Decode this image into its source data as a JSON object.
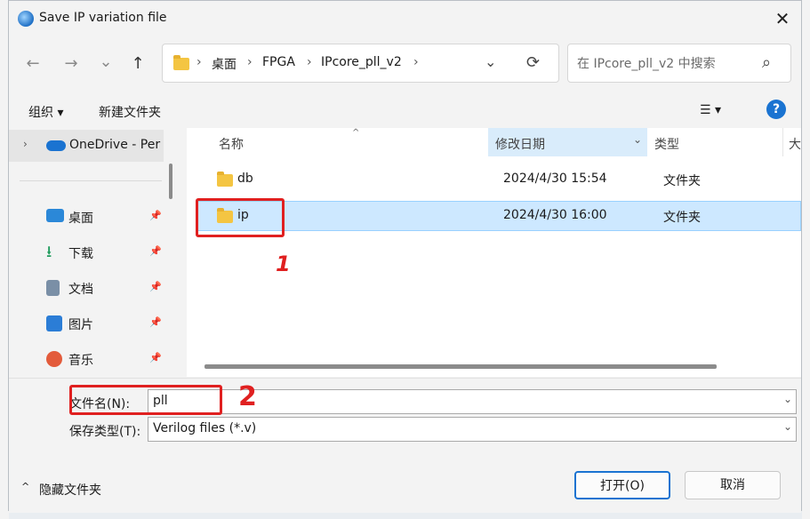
{
  "dialog": {
    "title": "Save IP variation file",
    "close_symbol": "✕"
  },
  "nav": {
    "back": "←",
    "forward": "→",
    "recent": "⌄",
    "up": "↑",
    "breadcrumb": [
      "桌面",
      "FPGA",
      "IPcore_pll_v2"
    ],
    "breadcrumb_sep": "›",
    "addr_dropdown": "⌄",
    "refresh": "⟳",
    "search_placeholder": "在 IPcore_pll_v2 中搜索",
    "search_icon": "⌕"
  },
  "toolbar": {
    "organize": "组织 ▾",
    "new_folder": "新建文件夹",
    "view_icon": "☰ ▾",
    "help": "?"
  },
  "sidebar": {
    "onedrive": "OneDrive - Per",
    "items": [
      {
        "label": "桌面",
        "icon": "desktop-icon",
        "color": "#2b88d8"
      },
      {
        "label": "下载",
        "icon": "download-icon",
        "color": "#1f9b5d"
      },
      {
        "label": "文档",
        "icon": "document-icon",
        "color": "#7a8fa6"
      },
      {
        "label": "图片",
        "icon": "picture-icon",
        "color": "#2b7dd6"
      },
      {
        "label": "音乐",
        "icon": "music-icon",
        "color": "#e35b3b"
      }
    ],
    "pin_symbol": "📌"
  },
  "columns": {
    "name": "名称",
    "date": "修改日期",
    "type": "类型",
    "size": "大"
  },
  "files": [
    {
      "name": "db",
      "date": "2024/4/30 15:54",
      "type": "文件夹"
    },
    {
      "name": "ip",
      "date": "2024/4/30 16:00",
      "type": "文件夹"
    }
  ],
  "form": {
    "filename_label": "文件名(N):",
    "filename_value": "pll",
    "filetype_label": "保存类型(T):",
    "filetype_value": "Verilog files (*.v)",
    "dropdown": "⌄"
  },
  "footer": {
    "hide_folders": "隐藏文件夹",
    "open": "打开(O)",
    "cancel": "取消"
  },
  "annotations": {
    "one": "1",
    "two": "2"
  },
  "colors": {
    "selection": "#cde8ff",
    "accent": "#1a73d1",
    "annotation": "#e02020"
  }
}
